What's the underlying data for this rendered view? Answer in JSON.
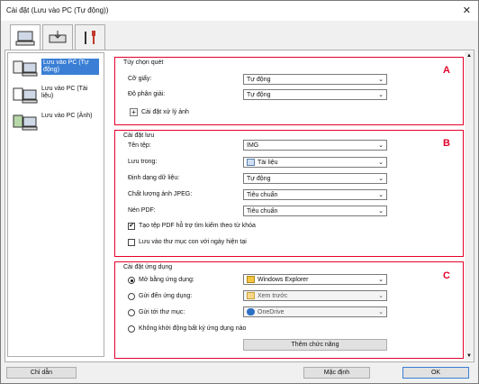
{
  "window": {
    "title": "Cài đặt (Lưu vào PC (Tự động))"
  },
  "tabs": [
    {
      "icon": "scan-from-computer-icon"
    },
    {
      "icon": "scan-from-panel-icon"
    },
    {
      "icon": "tools-icon"
    }
  ],
  "nav": [
    {
      "label": "Lưu vào PC (Tự động)",
      "selected": true
    },
    {
      "label": "Lưu vào PC (Tài liệu)",
      "selected": false
    },
    {
      "label": "Lưu vào PC (Ảnh)",
      "selected": false
    }
  ],
  "scan_options": {
    "caption": "Tùy chọn quét",
    "letter": "A",
    "paper_size_label": "Cỡ giấy:",
    "paper_size_value": "Tự động",
    "resolution_label": "Độ phân giải:",
    "resolution_value": "Tự động",
    "image_processing_label": "Cài đặt xử lý ảnh",
    "expand_symbol": "+"
  },
  "save_settings": {
    "caption": "Cài đặt lưu",
    "letter": "B",
    "file_name_label": "Tên tệp:",
    "file_name_value": "IMG",
    "save_in_label": "Lưu trong:",
    "save_in_value": "Tài liệu",
    "format_label": "Định dạng dữ liệu:",
    "format_value": "Tự động",
    "jpeg_label": "Chất lượng ảnh JPEG:",
    "jpeg_value": "Tiêu chuẩn",
    "pdf_label": "Nén PDF:",
    "pdf_value": "Tiêu chuẩn",
    "keyword_pdf_label": "Tạo tệp PDF hỗ trợ tìm kiếm theo từ khóa",
    "keyword_pdf_checked": true,
    "subfolder_label": "Lưu vào thư mục con với ngày hiện tại",
    "subfolder_checked": false,
    "check_mark": "✔"
  },
  "app_settings": {
    "caption": "Cài đặt ứng dụng",
    "letter": "C",
    "open_with_label": "Mở bằng ứng dụng:",
    "open_with_value": "Windows Explorer",
    "send_app_label": "Gửi đến ứng dụng:",
    "send_app_value": "Xem trước",
    "send_folder_label": "Gửi tới thư mục:",
    "send_folder_value": "OneDrive",
    "no_app_label": "Không khởi động bất kỳ ứng dụng nào",
    "add_function_label": "Thêm chức năng",
    "selected_option": "open_with"
  },
  "footer": {
    "guide_label": "Chỉ dẫn",
    "default_label": "Mặc định",
    "ok_label": "OK"
  },
  "colors": {
    "highlight": "#e4002b",
    "selection": "#3a7fd5"
  }
}
